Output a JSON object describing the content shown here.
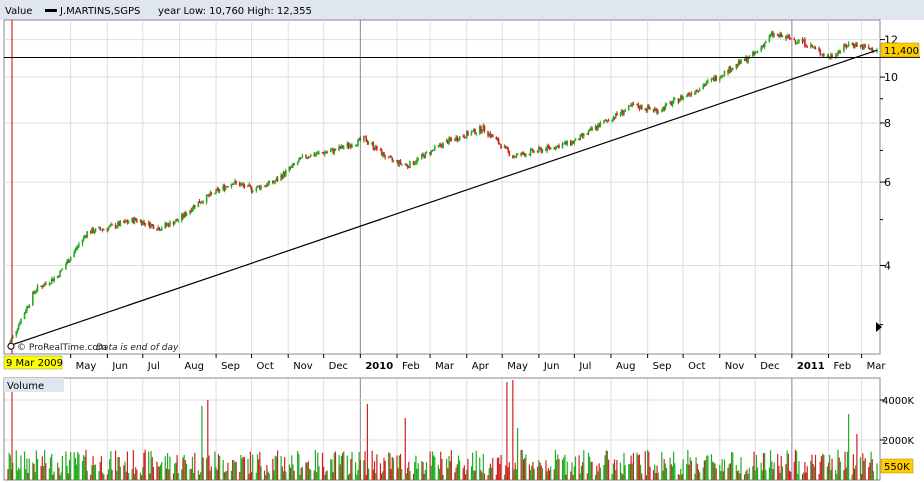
{
  "chart_data": [
    {
      "type": "candlestick",
      "panel": "price",
      "header": {
        "label": "Value",
        "series_name": "J.MARTINS,SGPS",
        "range_text": "year Low: 10,760  High: 12,355"
      },
      "y_scale": "log",
      "ylim": [
        2.6,
        13.2
      ],
      "y_ticks": [
        4,
        6,
        8,
        10,
        12
      ],
      "last_value": 11.4,
      "last_value_label": "11,400",
      "start_label": "9 Mar 2009",
      "watermark": "© ProRealTime.com",
      "watermark_note": "Data is end of day",
      "x_labels": [
        "May",
        "Jun",
        "Jul",
        "Aug",
        "Sep",
        "Oct",
        "Nov",
        "Dec",
        "2010",
        "Feb",
        "Mar",
        "Apr",
        "May",
        "Jun",
        "Jul",
        "Aug",
        "Sep",
        "Oct",
        "Nov",
        "Dec",
        "2011",
        "Feb",
        "Mar"
      ],
      "year_labels": [
        "2010",
        "2011"
      ],
      "price_path": [
        [
          "2009-03-09",
          2.7
        ],
        [
          "2009-04-01",
          3.55
        ],
        [
          "2009-04-20",
          3.8
        ],
        [
          "2009-05-15",
          4.7
        ],
        [
          "2009-06-01",
          4.8
        ],
        [
          "2009-06-25",
          5.0
        ],
        [
          "2009-07-15",
          4.8
        ],
        [
          "2009-08-01",
          5.0
        ],
        [
          "2009-08-15",
          5.4
        ],
        [
          "2009-09-15",
          6.0
        ],
        [
          "2009-10-01",
          5.8
        ],
        [
          "2009-10-20",
          6.0
        ],
        [
          "2009-11-15",
          6.8
        ],
        [
          "2009-12-10",
          7.0
        ],
        [
          "2010-01-05",
          7.4
        ],
        [
          "2010-01-25",
          6.7
        ],
        [
          "2010-02-10",
          6.5
        ],
        [
          "2010-03-15",
          7.3
        ],
        [
          "2010-04-15",
          7.8
        ],
        [
          "2010-05-10",
          6.8
        ],
        [
          "2010-06-01",
          7.0
        ],
        [
          "2010-07-01",
          7.3
        ],
        [
          "2010-07-25",
          8.0
        ],
        [
          "2010-08-20",
          8.7
        ],
        [
          "2010-09-10",
          8.5
        ],
        [
          "2010-10-15",
          9.5
        ],
        [
          "2010-11-15",
          10.6
        ],
        [
          "2010-12-01",
          11.2
        ],
        [
          "2010-12-15",
          12.3
        ],
        [
          "2011-01-10",
          11.9
        ],
        [
          "2011-02-01",
          11.0
        ],
        [
          "2011-02-20",
          11.8
        ],
        [
          "2011-03-10",
          11.4
        ]
      ],
      "trendline": [
        [
          "2009-03-09",
          2.7
        ],
        [
          "2011-03-14",
          11.4
        ]
      ],
      "horizontal_line": 11.0,
      "colors": {
        "up": "#22aa22",
        "down": "#cc2222",
        "cursor": "#cc0000",
        "grid": "#dedede",
        "badge": "#ffcc00"
      }
    },
    {
      "type": "bar",
      "panel": "volume",
      "label": "Volume",
      "y_ticks": [
        2000000,
        4000000
      ],
      "y_tick_labels": [
        "2000K",
        "4000K"
      ],
      "ylim": [
        0,
        5000000
      ],
      "last_value_label": "550K",
      "typical_volume": 800000,
      "spikes": [
        [
          "2009-08-20",
          3700000
        ],
        [
          "2009-08-25",
          4000000
        ],
        [
          "2009-09-05",
          3200000
        ],
        [
          "2010-01-07",
          3800000
        ],
        [
          "2010-02-08",
          3100000
        ],
        [
          "2010-04-10",
          4200000
        ],
        [
          "2010-05-05",
          4900000
        ],
        [
          "2010-05-10",
          5000000
        ],
        [
          "2010-05-14",
          2600000
        ],
        [
          "2011-02-18",
          3300000
        ],
        [
          "2011-02-25",
          2300000
        ]
      ]
    }
  ]
}
